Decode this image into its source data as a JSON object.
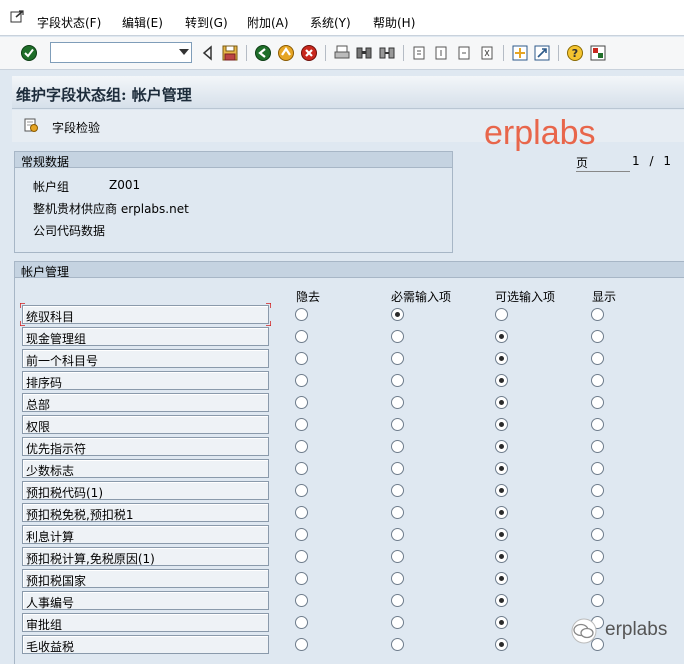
{
  "menu": {
    "items": [
      "字段状态(F)",
      "编辑(E)",
      "转到(G)",
      "附加(A)",
      "系统(Y)",
      "帮助(H)"
    ]
  },
  "toolbar": {
    "command_value": ""
  },
  "title": "维护字段状态组: 帐户管理",
  "app_toolbar": {
    "field_check_label": "字段检验"
  },
  "watermark": {
    "top": "erplabs",
    "bottom": "erplabs"
  },
  "page": {
    "label": "页",
    "current": "1",
    "separator": "/",
    "total": "1"
  },
  "general": {
    "title": "常规数据",
    "account_group_label": "帐户组",
    "account_group_value": "Z001",
    "description": "整机贵材供应商 erplabs.net",
    "company_code_data": "公司代码数据"
  },
  "account_mgmt": {
    "title": "帐户管理",
    "columns": [
      "隐去",
      "必需输入项",
      "可选输入项",
      "显示"
    ],
    "rows": [
      {
        "label": "统驭科目",
        "selected": 1
      },
      {
        "label": "现金管理组",
        "selected": 2
      },
      {
        "label": "前一个科目号",
        "selected": 2
      },
      {
        "label": "排序码",
        "selected": 2
      },
      {
        "label": "总部",
        "selected": 2
      },
      {
        "label": "权限",
        "selected": 2
      },
      {
        "label": "优先指示符",
        "selected": 2
      },
      {
        "label": "少数标志",
        "selected": 2
      },
      {
        "label": "预扣税代码(1)",
        "selected": 2
      },
      {
        "label": "预扣税免税,预扣税1",
        "selected": 2
      },
      {
        "label": "利息计算",
        "selected": 2
      },
      {
        "label": "预扣税计算,免税原因(1)",
        "selected": 2
      },
      {
        "label": "预扣税国家",
        "selected": 2
      },
      {
        "label": "人事编号",
        "selected": 2
      },
      {
        "label": "审批组",
        "selected": 2
      },
      {
        "label": "毛收益税",
        "selected": 2
      }
    ]
  }
}
